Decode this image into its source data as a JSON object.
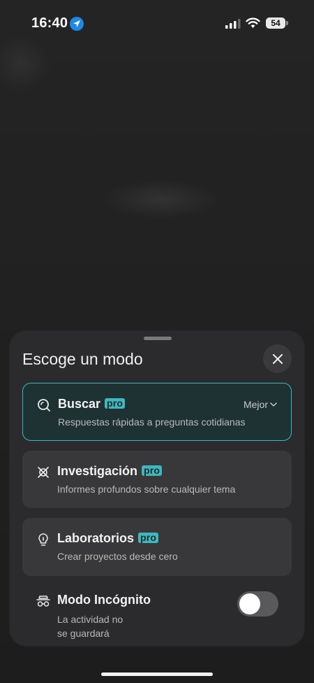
{
  "status_bar": {
    "time": "16:40",
    "battery": "54"
  },
  "sheet": {
    "title": "Escoge un modo",
    "modes": [
      {
        "title": "Buscar",
        "badge": "pro",
        "description": "Respuestas rápidas a preguntas cotidianas",
        "option": "Mejor",
        "selected": true,
        "icon": "search-icon"
      },
      {
        "title": "Investigación",
        "badge": "pro",
        "description": "Informes profundos sobre cualquier tema",
        "selected": false,
        "icon": "research-icon"
      },
      {
        "title": "Laboratorios",
        "badge": "pro",
        "description": "Crear proyectos desde cero",
        "selected": false,
        "icon": "lightbulb-icon"
      }
    ],
    "incognito": {
      "title": "Modo Incógnito",
      "description_line1": "La actividad no",
      "description_line2": "se guardará",
      "enabled": false,
      "icon": "incognito-icon"
    }
  },
  "colors": {
    "accent": "#3fb8bd",
    "sheet_bg": "#2b2b2d",
    "card_bg": "#38383a",
    "selected_bg": "#1e3234"
  }
}
